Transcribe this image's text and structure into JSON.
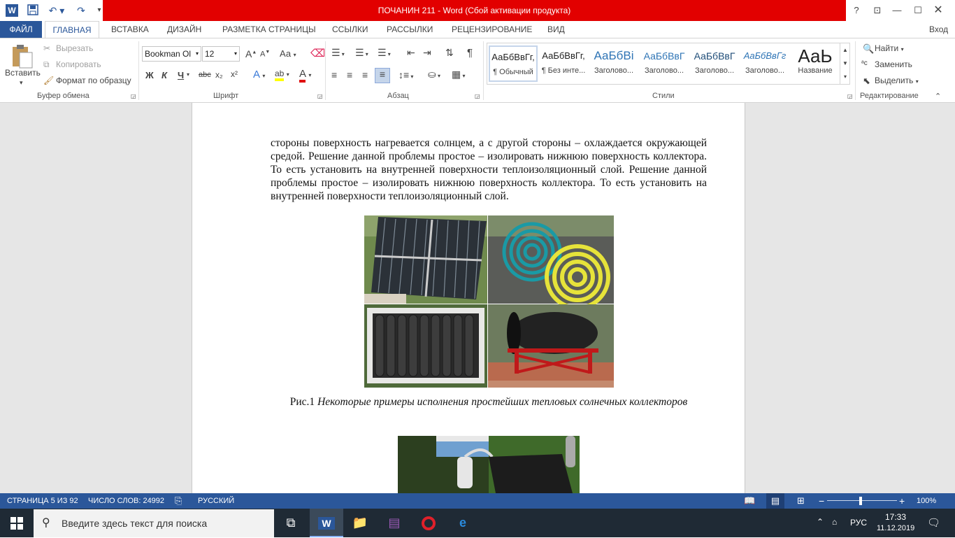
{
  "window": {
    "title": "ПОЧАНИН 211 -  Word (Сбой активации продукта)",
    "help": "?",
    "signin": "Вход"
  },
  "tabs": [
    "ФАЙЛ",
    "ГЛАВНАЯ",
    "ВСТАВКА",
    "ДИЗАЙН",
    "РАЗМЕТКА СТРАНИЦЫ",
    "ССЫЛКИ",
    "РАССЫЛКИ",
    "РЕЦЕНЗИРОВАНИЕ",
    "ВИД"
  ],
  "clipboard": {
    "paste": "Вставить",
    "cut": "Вырезать",
    "copy": "Копировать",
    "format_painter": "Формат по образцу",
    "label": "Буфер обмена"
  },
  "font": {
    "name": "Bookman Ol",
    "size": "12",
    "bold": "Ж",
    "italic": "К",
    "underline": "Ч",
    "strike": "abc",
    "sub": "x₂",
    "sup": "x²",
    "case": "Аа",
    "grow": "A",
    "shrink": "A",
    "color_a": "A",
    "effects": "A",
    "label": "Шрифт"
  },
  "paragraph": {
    "label": "Абзац",
    "pilcrow": "¶"
  },
  "styles": {
    "label": "Стили",
    "items": [
      {
        "preview": "АаБбВвГг,",
        "name": "¶ Обычный"
      },
      {
        "preview": "АаБбВвГг,",
        "name": "¶ Без инте..."
      },
      {
        "preview": "АаБбВі",
        "name": "Заголово..."
      },
      {
        "preview": "АаБбВвГ",
        "name": "Заголово..."
      },
      {
        "preview": "АаБбВвГ",
        "name": "Заголово..."
      },
      {
        "preview": "АаБбВвГг",
        "name": "Заголово..."
      },
      {
        "preview": "АаЬ",
        "name": "Название"
      }
    ]
  },
  "editing": {
    "find": "Найти",
    "replace": "Заменить",
    "select": "Выделить",
    "label": "Редактирование"
  },
  "document": {
    "paragraph": "стороны поверхность нагревается солнцем, а с другой стороны – охлаждается окружающей средой. Решение данной проблемы простое – изолировать нижнюю поверхность коллектора. То есть установить на внутренней поверхности теплоизоляционный слой. Решение данной проблемы простое – изолировать нижнюю поверхность коллектора. То есть установить на внутренней поверхности теплоизоляционный слой.",
    "caption_prefix": "Рис.1",
    "caption_italic": "Некоторые примеры исполнения простейших тепловых солнечных коллекторов"
  },
  "status": {
    "page": "СТРАНИЦА 5 ИЗ 92",
    "words": "ЧИСЛО СЛОВ: 24992",
    "language": "РУССКИЙ",
    "zoom": "100%",
    "zoom_minus": "−",
    "zoom_plus": "+"
  },
  "taskbar": {
    "search_placeholder": "Введите здесь текст для поиска",
    "lang": "РУС",
    "time": "17:33",
    "date": "11.12.2019"
  }
}
